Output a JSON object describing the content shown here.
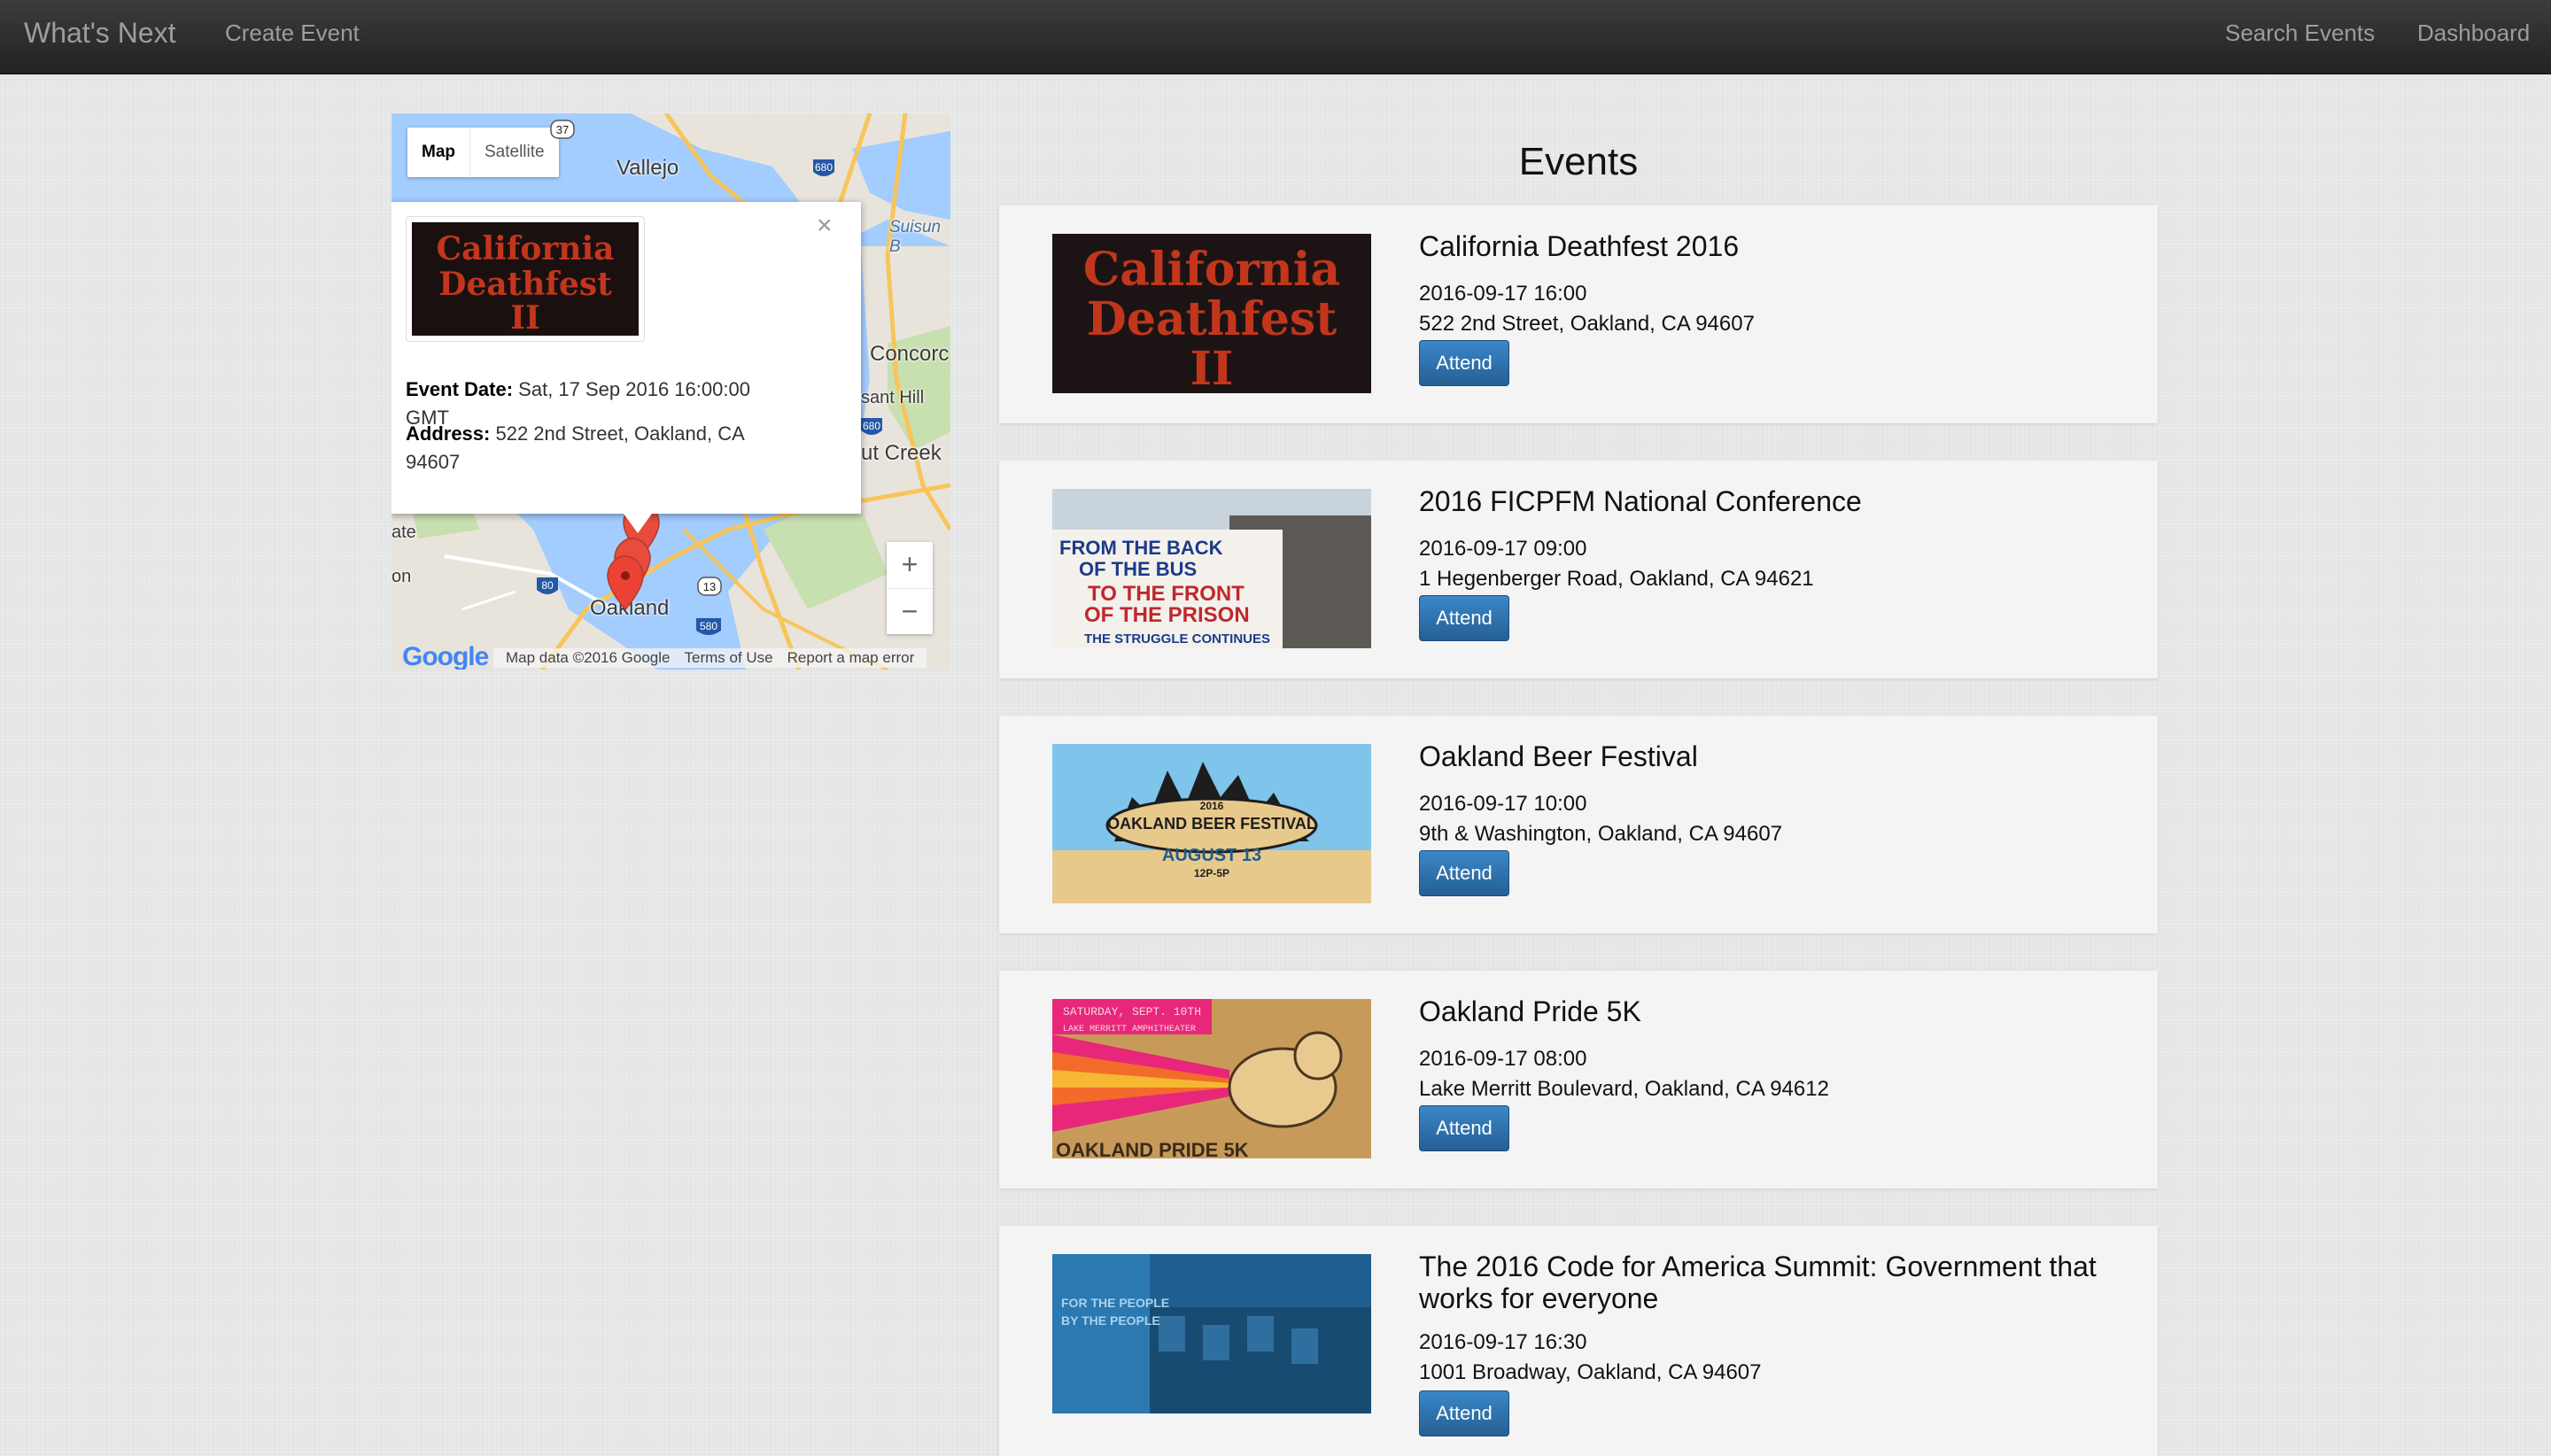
{
  "navbar": {
    "brand": "What's Next",
    "create_event": "Create Event",
    "search_events": "Search Events",
    "dashboard": "Dashboard"
  },
  "map": {
    "type_map": "Map",
    "type_satellite": "Satellite",
    "cities": [
      "Vallejo",
      "Suisun B",
      "Concorc",
      "sant Hill",
      "ut Creek",
      "Oakland",
      "ate",
      "on"
    ],
    "shields": [
      "37",
      "680",
      "680",
      "80",
      "13",
      "580"
    ],
    "zoom_in": "+",
    "zoom_out": "−",
    "google": "Google",
    "data_credit": "Map data ©2016 Google",
    "terms": "Terms of Use",
    "report": "Report a map error",
    "info": {
      "close": "×",
      "date_label": "Event Date:",
      "date_value": "Sat, 17 Sep 2016 16:00:00 GMT",
      "address_label": "Address:",
      "address_value": "522 2nd Street, Oakland, CA 94607",
      "image_text": [
        "California",
        "Deathfest",
        "II"
      ]
    }
  },
  "events_title": "Events",
  "attend_label": "Attend",
  "events": [
    {
      "title": "California Deathfest 2016",
      "datetime": "2016-09-17 16:00",
      "address": "522 2nd Street, Oakland, CA 94607",
      "image_text": [
        "California",
        "Deathfest",
        "II"
      ]
    },
    {
      "title": "2016 FICPFM National Conference",
      "datetime": "2016-09-17 09:00",
      "address": "1 Hegenberger Road, Oakland, CA 94621",
      "image_text": [
        "FROM THE BACK",
        "OF THE BUS",
        "TO THE FRONT",
        "OF THE PRISON",
        "THE STRUGGLE CONTINUES"
      ]
    },
    {
      "title": "Oakland Beer Festival",
      "datetime": "2016-09-17 10:00",
      "address": "9th & Washington, Oakland, CA 94607",
      "image_text": [
        "2016",
        "OAKLAND BEER FESTIVAL",
        "AUGUST 13",
        "12P-5P"
      ]
    },
    {
      "title": "Oakland Pride 5K",
      "datetime": "2016-09-17 08:00",
      "address": "Lake Merritt Boulevard, Oakland, CA 94612",
      "image_text": [
        "SATURDAY, SEPT. 10TH",
        "LAKE MERRITT AMPHITHEATER",
        "OAKLAND PRIDE 5K"
      ]
    },
    {
      "title": "The 2016 Code for America Summit: Government that works for everyone",
      "datetime": "2016-09-17 16:30",
      "address": "1001 Broadway, Oakland, CA 94607",
      "image_text": [
        "FOR THE PEOPLE",
        "BY THE PEOPLE"
      ]
    }
  ],
  "colors": {
    "navbar": "#222222",
    "attend_button": "#2e6da4",
    "page_background": "#e6e7e9",
    "card_background": "#f4f4f4"
  }
}
